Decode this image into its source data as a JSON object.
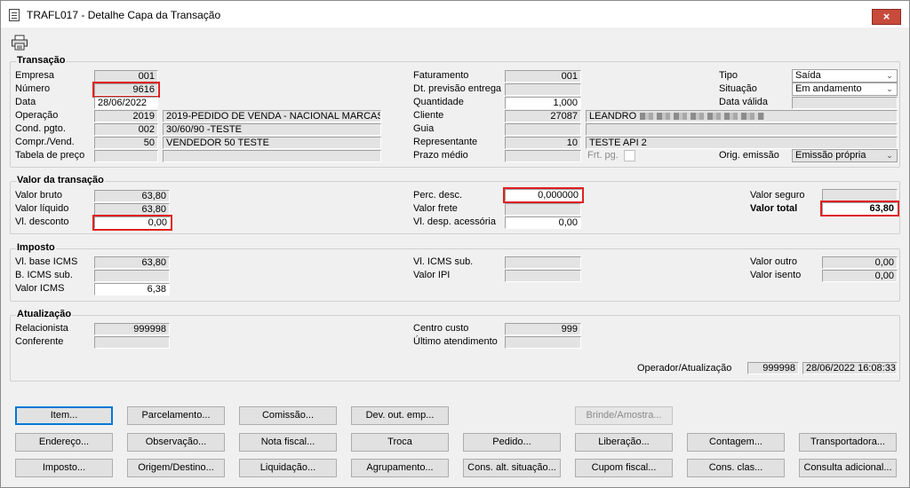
{
  "window": {
    "title": "TRAFL017 - Detalhe Capa da Transação",
    "close": "×"
  },
  "toolbar": {
    "print_icon": "printer-icon"
  },
  "transacao": {
    "title": "Transação",
    "labels": {
      "empresa": "Empresa",
      "numero": "Número",
      "data": "Data",
      "operacao": "Operação",
      "cond_pgto": "Cond. pgto.",
      "compr_vend": "Compr./Vend.",
      "tabela_preco": "Tabela de preço",
      "faturamento": "Faturamento",
      "dt_previsao": "Dt. previsão entrega",
      "quantidade": "Quantidade",
      "cliente": "Cliente",
      "guia": "Guia",
      "representante": "Representante",
      "prazo_medio": "Prazo médio",
      "frt_pg": "Frt. pg.",
      "tipo": "Tipo",
      "situacao": "Situação",
      "data_valida": "Data válida",
      "orig_emissao": "Orig. emissão"
    },
    "values": {
      "empresa": "001",
      "numero": "9616",
      "data": "28/06/2022",
      "operacao_code": "2019",
      "operacao_desc": "2019-PEDIDO DE VENDA - NACIONAL MARCAS",
      "cond_pgto_code": "002",
      "cond_pgto_desc": "30/60/90 -TESTE",
      "compr_vend_code": "50",
      "compr_vend_desc": "VENDEDOR 50 TESTE",
      "tabela_preco_code": "",
      "tabela_preco_desc": "",
      "faturamento": "001",
      "dt_previsao": "",
      "quantidade": "1,000",
      "cliente_code": "27087",
      "cliente_name": "LEANDRO",
      "guia_code": "",
      "guia_desc": "",
      "representante_code": "10",
      "representante_name": "TESTE API 2",
      "prazo_medio": "",
      "tipo": "Saída",
      "situacao": "Em andamento",
      "data_valida": "",
      "orig_emissao": "Emissão própria"
    }
  },
  "valor_transacao": {
    "title": "Valor da transação",
    "labels": {
      "valor_bruto": "Valor bruto",
      "valor_liquido": "Valor líquido",
      "vl_desconto": "Vl. desconto",
      "perc_desc": "Perc. desc.",
      "valor_frete": "Valor frete",
      "vl_desp_acessoria": "Vl. desp. acessória",
      "valor_seguro": "Valor seguro",
      "valor_total": "Valor total"
    },
    "values": {
      "valor_bruto": "63,80",
      "valor_liquido": "63,80",
      "vl_desconto": "0,00",
      "perc_desc": "0,000000",
      "valor_frete": "",
      "vl_desp_acessoria": "0,00",
      "valor_seguro": "",
      "valor_total": "63,80"
    }
  },
  "imposto": {
    "title": "Imposto",
    "labels": {
      "vl_base_icms": "Vl. base ICMS",
      "b_icms_sub": "B. ICMS sub.",
      "valor_icms": "Valor ICMS",
      "vl_icms_sub": "Vl. ICMS sub.",
      "valor_ipi": "Valor IPI",
      "valor_outro": "Valor outro",
      "valor_isento": "Valor isento"
    },
    "values": {
      "vl_base_icms": "63,80",
      "b_icms_sub": "",
      "valor_icms": "6,38",
      "vl_icms_sub": "",
      "valor_ipi": "",
      "valor_outro": "0,00",
      "valor_isento": "0,00"
    }
  },
  "atualizacao": {
    "title": "Atualização",
    "labels": {
      "relacionista": "Relacionista",
      "conferente": "Conferente",
      "centro_custo": "Centro custo",
      "ultimo_atendimento": "Último atendimento",
      "operador_atualizacao": "Operador/Atualização"
    },
    "values": {
      "relacionista": "999998",
      "conferente": "",
      "centro_custo": "999",
      "ultimo_atendimento": "",
      "operador": "999998",
      "data_hora": "28/06/2022 16:08:33"
    }
  },
  "buttons": {
    "row1": [
      "Item...",
      "Parcelamento...",
      "Comissão...",
      "Dev. out. emp...",
      "Brinde/Amostra..."
    ],
    "row2": [
      "Endereço...",
      "Observação...",
      "Nota fiscal...",
      "Troca",
      "Pedido...",
      "Liberação...",
      "Contagem...",
      "Transportadora..."
    ],
    "row3": [
      "Imposto...",
      "Origem/Destino...",
      "Liquidação...",
      "Agrupamento...",
      "Cons. alt. situação...",
      "Cupom fiscal...",
      "Cons. clas...",
      "Consulta adicional..."
    ]
  },
  "colors": {
    "highlight": "#e02020",
    "focus": "#0078d7",
    "close": "#c74a3b"
  }
}
